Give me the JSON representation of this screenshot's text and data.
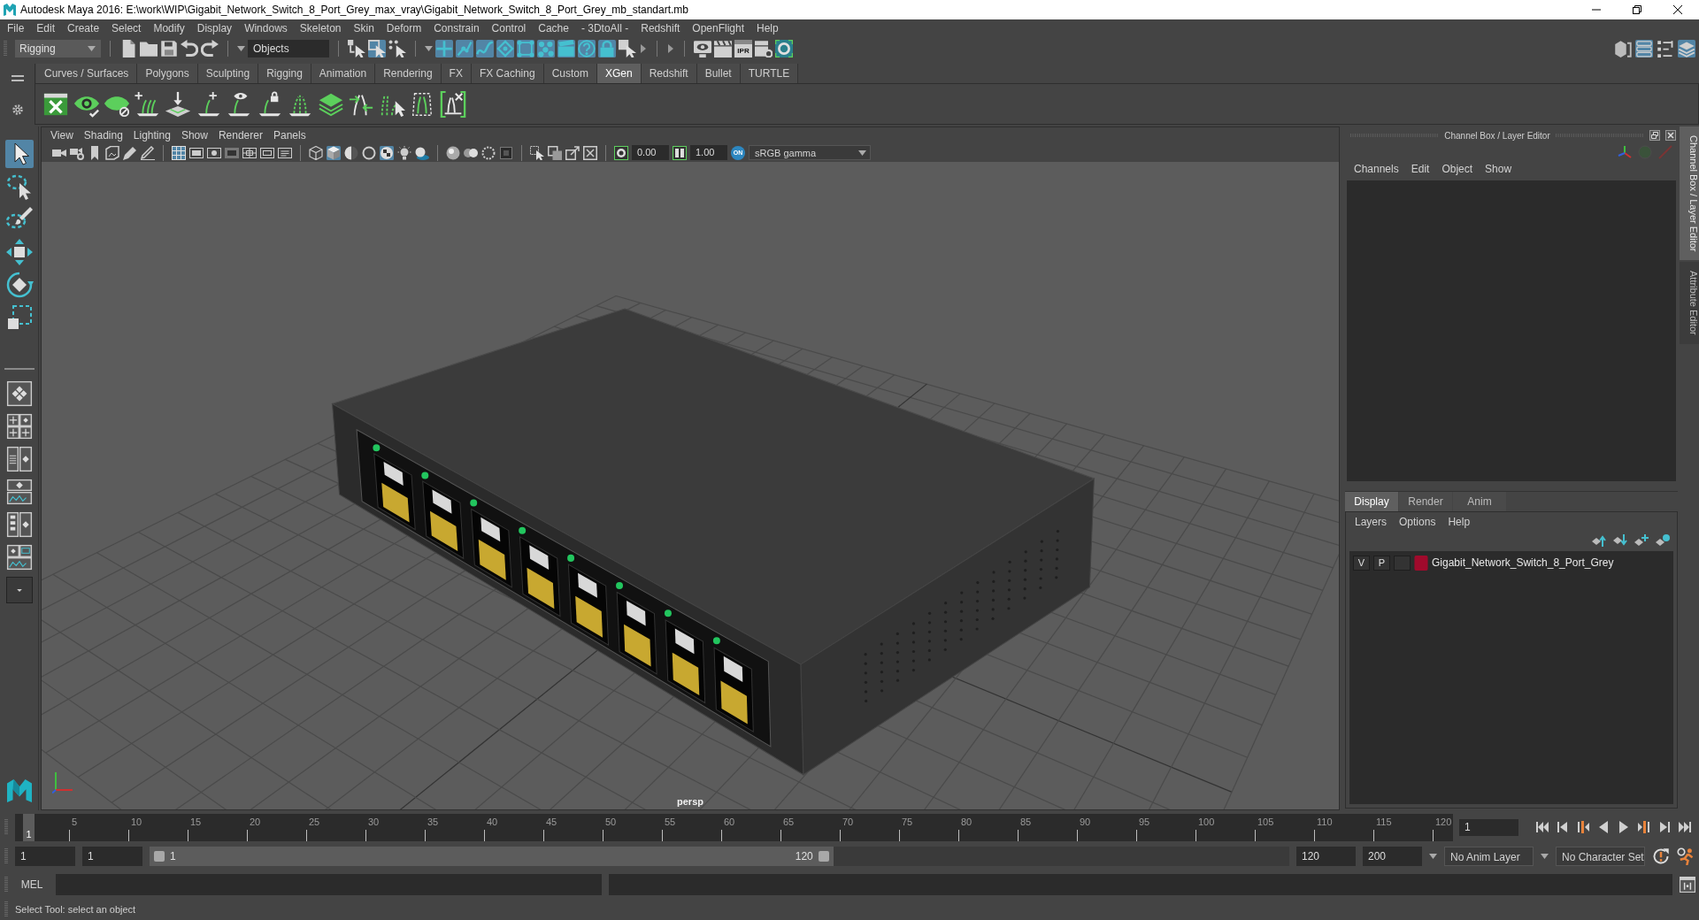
{
  "window": {
    "title": "Autodesk Maya 2016: E:\\work\\WIP\\Gigabit_Network_Switch_8_Port_Grey_max_vray\\Gigabit_Network_Switch_8_Port_Grey_mb_standart.mb"
  },
  "menu_bar": [
    "File",
    "Edit",
    "Create",
    "Select",
    "Modify",
    "Display",
    "Windows",
    "Skeleton",
    "Skin",
    "Deform",
    "Constrain",
    "Control",
    "Cache",
    "- 3DtoAll -",
    "Redshift",
    "OpenFlight",
    "Help"
  ],
  "status_line": {
    "menu_set": "Rigging",
    "selection_mode": "Objects",
    "select_mode_buttons": [
      {
        "selected": false
      },
      {
        "selected": true
      },
      {
        "selected": false
      }
    ],
    "mask_buttons": [
      {
        "on": true
      },
      {
        "on": true
      },
      {
        "on": true
      },
      {
        "on": true
      },
      {
        "on": true
      },
      {
        "on": true
      },
      {
        "on": true
      },
      {
        "on": true
      },
      {
        "on": true
      },
      {
        "on": false
      }
    ],
    "ipr_label": "IPR",
    "workspace_buttons": [
      {
        "on": false
      },
      {
        "on": true
      },
      {
        "on": false
      },
      {
        "on": true
      }
    ]
  },
  "shelf": {
    "tabs": [
      {
        "label": "Curves / Surfaces",
        "selected": false
      },
      {
        "label": "Polygons",
        "selected": false
      },
      {
        "label": "Sculpting",
        "selected": false
      },
      {
        "label": "Rigging",
        "selected": false
      },
      {
        "label": "Animation",
        "selected": false
      },
      {
        "label": "Rendering",
        "selected": false
      },
      {
        "label": "FX",
        "selected": false
      },
      {
        "label": "FX Caching",
        "selected": false
      },
      {
        "label": "Custom",
        "selected": false
      },
      {
        "label": "XGen",
        "selected": true
      },
      {
        "label": "Redshift",
        "selected": false
      },
      {
        "label": "Bullet",
        "selected": false
      },
      {
        "label": "TURTLE",
        "selected": false
      }
    ]
  },
  "toolbox": {
    "tools": [
      {
        "selected": true
      },
      {
        "selected": false
      },
      {
        "selected": false
      },
      {
        "selected": false
      },
      {
        "selected": false
      },
      {
        "selected": false
      }
    ]
  },
  "viewport": {
    "menu": [
      "View",
      "Shading",
      "Lighting",
      "Show",
      "Renderer",
      "Panels"
    ],
    "toolbar_buttons": [
      {
        "on": false
      },
      {
        "on": false
      },
      {
        "on": false
      },
      {
        "on": false
      },
      {
        "on": false
      },
      {
        "on": false
      },
      {
        "on": true
      },
      {
        "on": false
      },
      {
        "on": false
      },
      {
        "on": false
      },
      {
        "on": false
      },
      {
        "on": false
      },
      {
        "on": false
      },
      {
        "on": false
      },
      {
        "on": true
      },
      {
        "on": false
      },
      {
        "on": false
      },
      {
        "on": true
      },
      {
        "on": false
      },
      {
        "on": false
      },
      {
        "on": false
      },
      {
        "on": false
      },
      {
        "on": false
      },
      {
        "on": false
      },
      {
        "on": false
      },
      {
        "on": false
      },
      {
        "on": false
      },
      {
        "on": false
      }
    ],
    "exposure": "0.00",
    "gamma": "1.00",
    "color_management": "ON",
    "view_transform": "sRGB gamma",
    "camera": "persp"
  },
  "channel_box": {
    "title": "Channel Box / Layer Editor",
    "menu": [
      "Channels",
      "Edit",
      "Object",
      "Show"
    ]
  },
  "layer_editor": {
    "tabs": [
      {
        "label": "Display",
        "selected": true
      },
      {
        "label": "Render",
        "selected": false
      },
      {
        "label": "Anim",
        "selected": false
      }
    ],
    "menu": [
      "Layers",
      "Options",
      "Help"
    ],
    "layers": [
      {
        "visibility": "V",
        "playback": "P",
        "color": "#a00a2c",
        "name": "Gigabit_Network_Switch_8_Port_Grey"
      }
    ]
  },
  "side_tabs": [
    {
      "label": "Channel Box / Layer Editor",
      "selected": true
    },
    {
      "label": "Attribute Editor",
      "selected": false
    }
  ],
  "time_slider": {
    "frame_labels": [
      "5",
      "10",
      "15",
      "20",
      "25",
      "30",
      "35",
      "40",
      "45",
      "50",
      "55",
      "60",
      "65",
      "70",
      "75",
      "80",
      "85",
      "90",
      "95",
      "100",
      "105",
      "110",
      "115",
      "120"
    ],
    "current_frame": "1",
    "level": 0,
    "current_frame_field": "1"
  },
  "range_slider": {
    "start_time": "1",
    "playback_start": "1",
    "range_start": "1",
    "range_end": "120",
    "level": 0.6,
    "playback_end": "120",
    "end_time": "200",
    "anim_layer": "No Anim Layer",
    "character_set": "No Character Set"
  },
  "command_line": {
    "language": "MEL"
  },
  "help_line": "Select Tool: select an object"
}
